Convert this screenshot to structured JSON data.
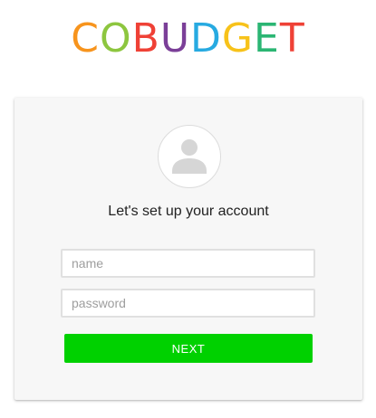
{
  "logo": {
    "letters": [
      {
        "char": "C",
        "color": "#f7941d"
      },
      {
        "char": "O",
        "color": "#8dc63f"
      },
      {
        "char": "B",
        "color": "#ef4136"
      },
      {
        "char": "U",
        "color": "#7b3f98"
      },
      {
        "char": "D",
        "color": "#27aae1"
      },
      {
        "char": "G",
        "color": "#f7c21a"
      },
      {
        "char": "E",
        "color": "#2bb673"
      },
      {
        "char": "T",
        "color": "#ef4136"
      }
    ]
  },
  "card": {
    "avatar_icon": "user-silhouette-icon",
    "heading": "Let's set up your account",
    "fields": {
      "name": {
        "placeholder": "name",
        "value": ""
      },
      "password": {
        "placeholder": "password",
        "value": ""
      }
    },
    "next_label": "NEXT"
  },
  "colors": {
    "button": "#00d100",
    "card_background": "#f7f7f7",
    "avatar_glyph": "#d6d6d6"
  }
}
